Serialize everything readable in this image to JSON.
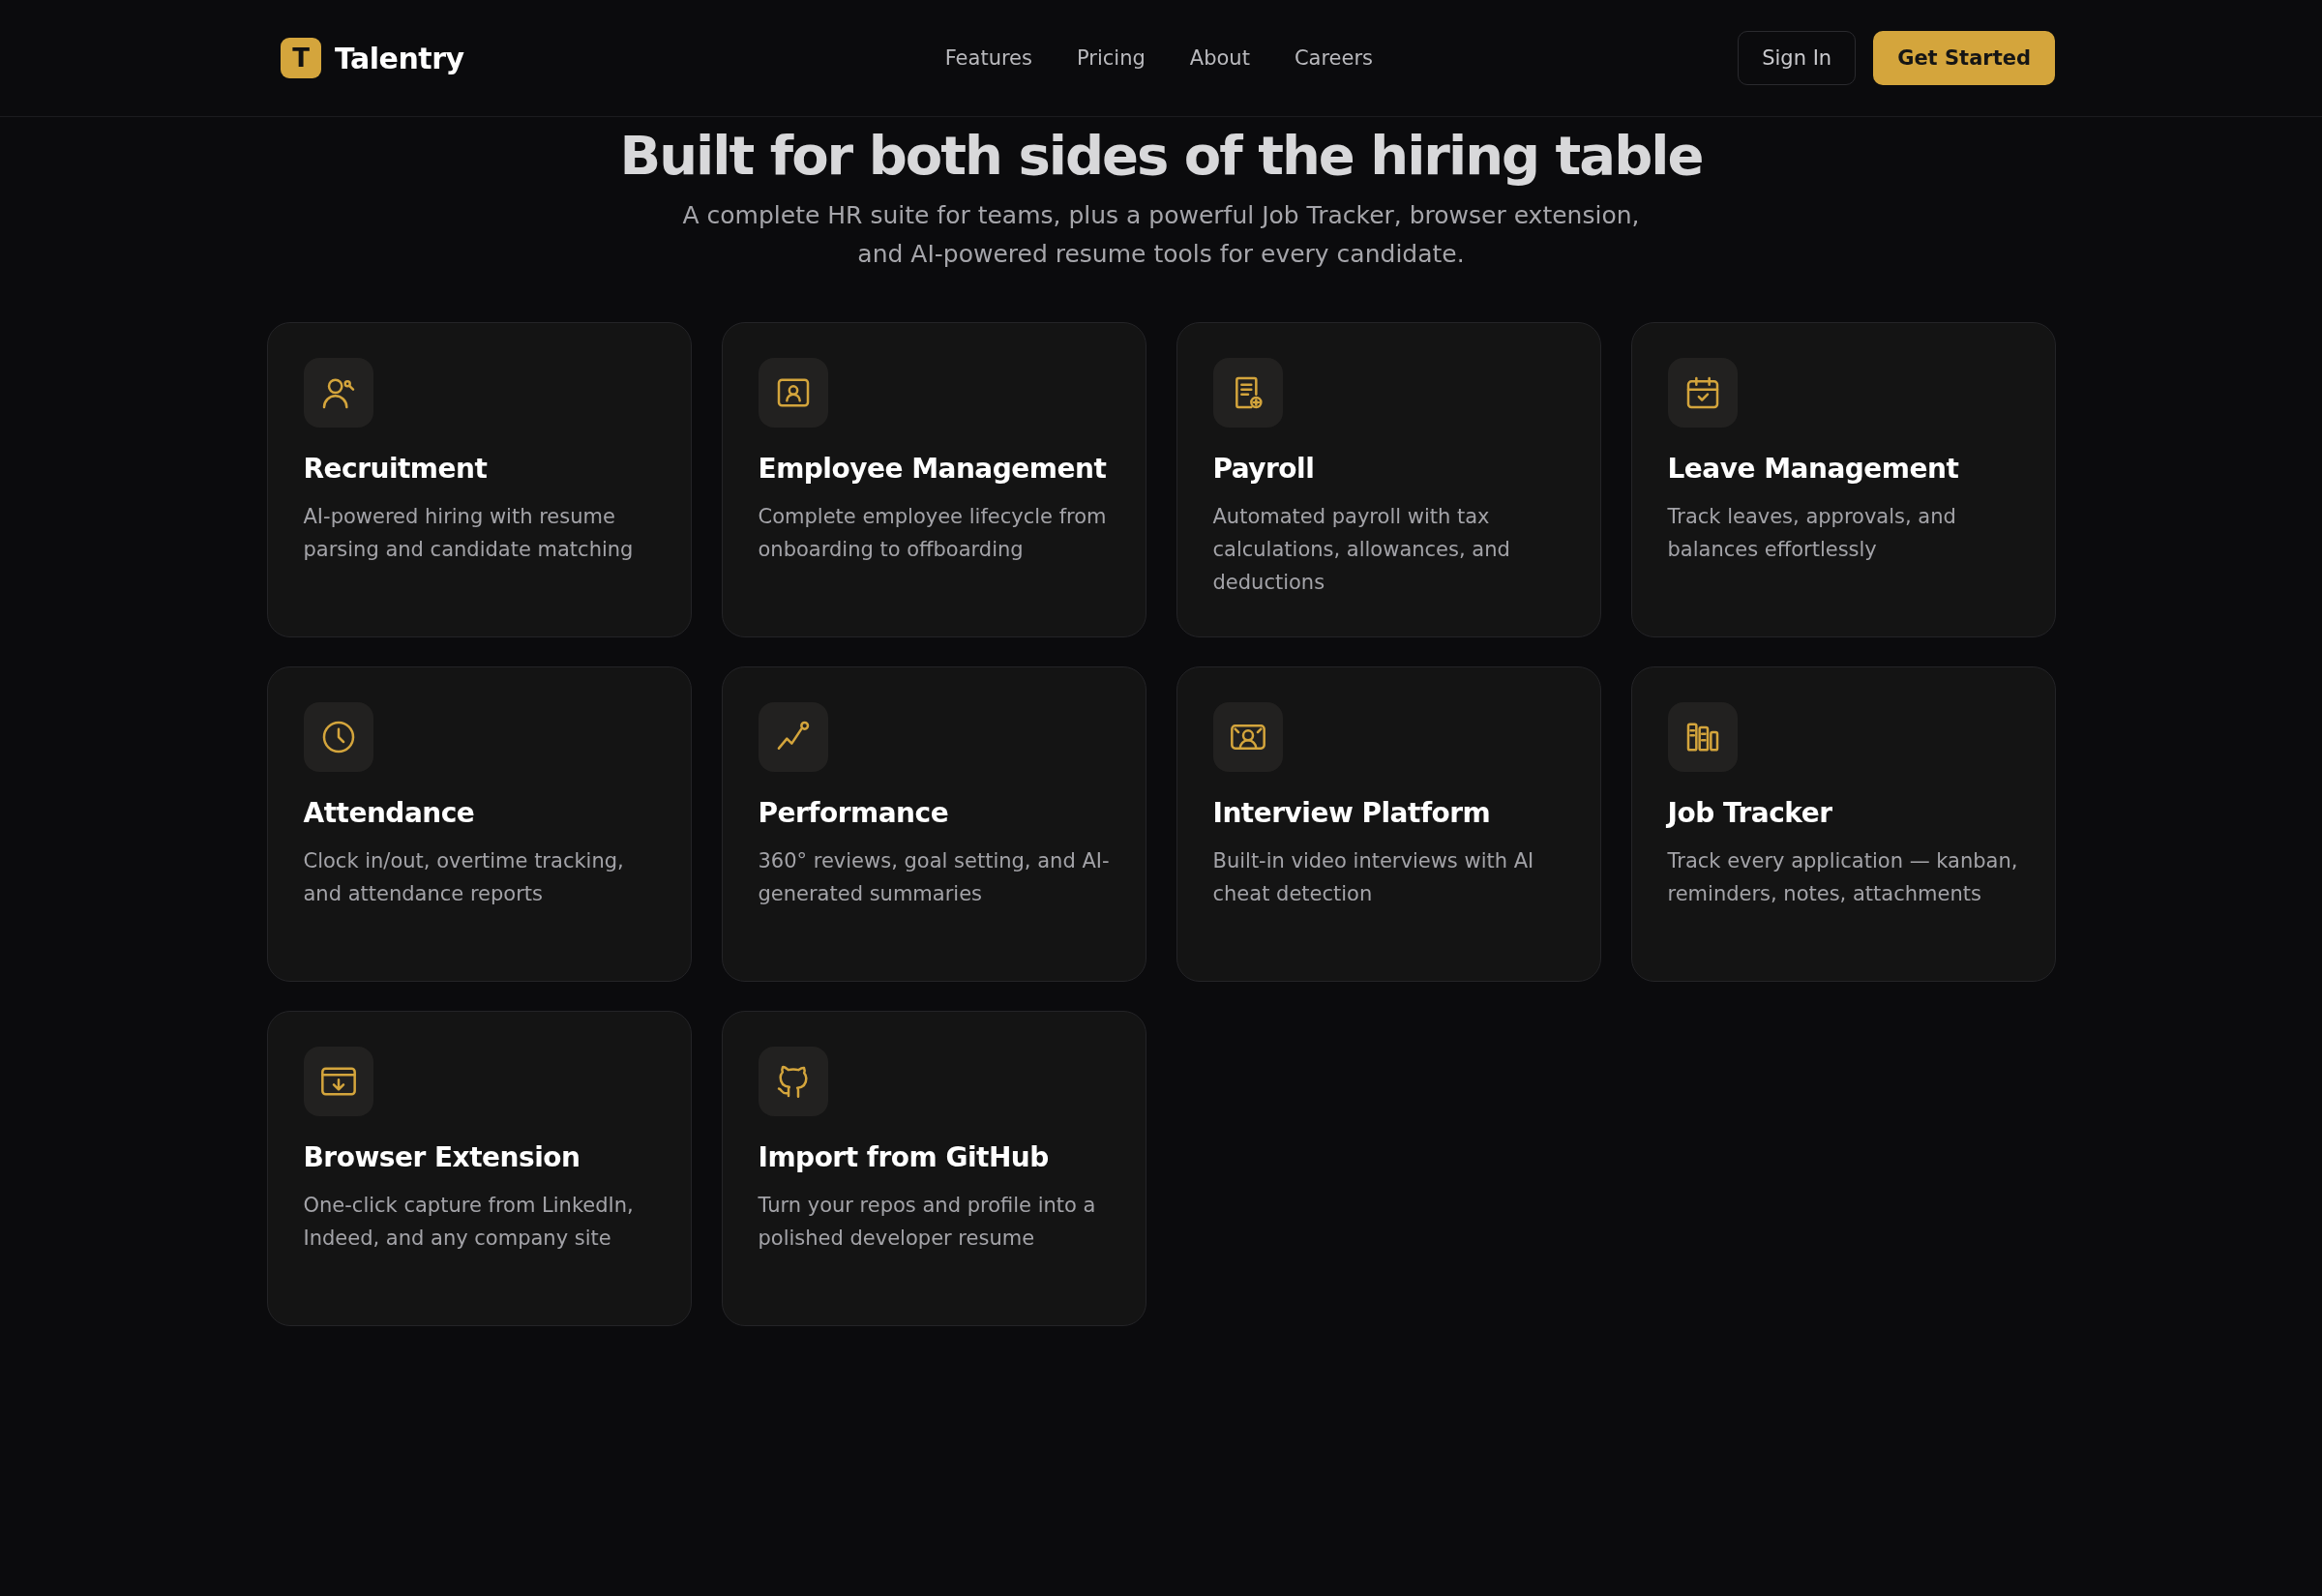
{
  "header": {
    "logo_letter": "T",
    "brand": "Talentry",
    "nav": [
      "Features",
      "Pricing",
      "About",
      "Careers"
    ],
    "sign_in": "Sign In",
    "cta": "Get Started"
  },
  "hero": {
    "title": "Built for both sides of the hiring table",
    "subtitle_lines": [
      "A complete HR suite for teams, plus a powerful Job Tracker, browser extension,",
      "and AI-powered resume tools for every candidate."
    ]
  },
  "features": [
    {
      "title": "Recruitment",
      "description": "AI-powered hiring with resume parsing and candidate matching"
    },
    {
      "title": "Employee Management",
      "description": "Complete employee lifecycle from onboarding to offboarding"
    },
    {
      "title": "Payroll",
      "description": "Automated payroll with tax calculations, allowances, and deductions"
    },
    {
      "title": "Leave Management",
      "description": "Track leaves, approvals, and balances effortlessly"
    },
    {
      "title": "Attendance",
      "description": "Clock in/out, overtime tracking, and attendance reports"
    },
    {
      "title": "Performance",
      "description": "360° reviews, goal setting, and AI-generated summaries"
    },
    {
      "title": "Interview Platform",
      "description": "Built-in video interviews with AI cheat detection"
    },
    {
      "title": "Job Tracker",
      "description": "Track every application — kanban, reminders, notes, attachments"
    },
    {
      "title": "Browser Extension",
      "description": "One-click capture from LinkedIn, Indeed, and any company site"
    },
    {
      "title": "Import from GitHub",
      "description": "Turn your repos and profile into a polished developer resume"
    }
  ]
}
